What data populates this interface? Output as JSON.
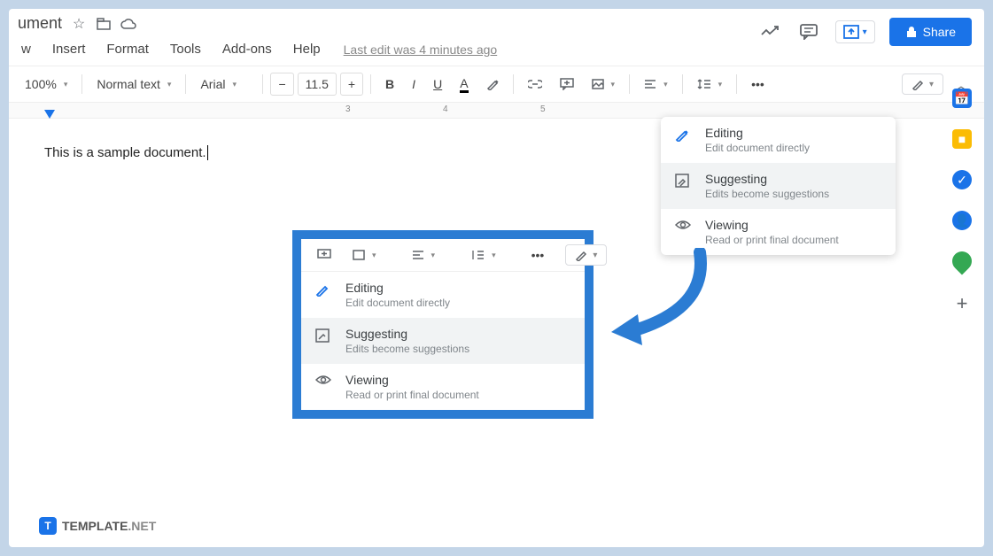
{
  "title": "ument",
  "menus": [
    "w",
    "Insert",
    "Format",
    "Tools",
    "Add-ons",
    "Help"
  ],
  "last_edit": "Last edit was 4 minutes ago",
  "share": "Share",
  "toolbar": {
    "zoom": "100%",
    "style": "Normal text",
    "font": "Arial",
    "size": "11.5"
  },
  "ruler": {
    "m3": "3",
    "m4": "4",
    "m5": "5"
  },
  "sample_text": "This is a sample document.",
  "mode_menu": {
    "editing": {
      "title": "Editing",
      "sub": "Edit document directly"
    },
    "suggesting": {
      "title": "Suggesting",
      "sub": "Edits become suggestions"
    },
    "viewing": {
      "title": "Viewing",
      "sub": "Read or print final document"
    }
  },
  "mode_menu2": {
    "viewing_sub": "Read or print final document"
  },
  "brand": {
    "t": "T",
    "name": "TEMPLATE",
    "suffix": ".NET"
  }
}
